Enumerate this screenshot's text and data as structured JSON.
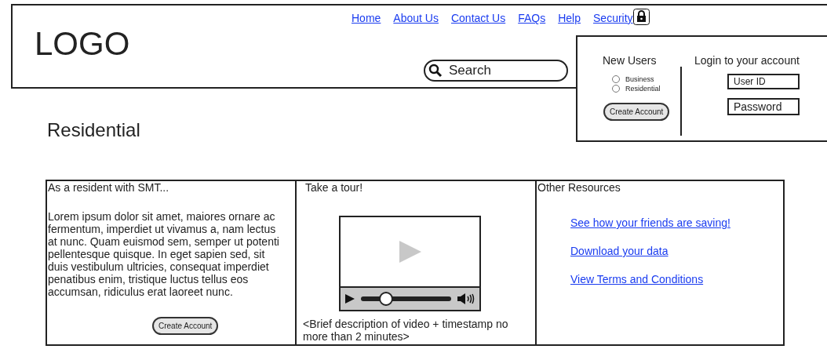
{
  "header": {
    "logo": "LOGO",
    "nav": [
      {
        "label": "Home"
      },
      {
        "label": "About Us"
      },
      {
        "label": "Contact Us"
      },
      {
        "label": "FAQs"
      },
      {
        "label": "Help"
      },
      {
        "label": "Security"
      }
    ],
    "search": {
      "placeholder": "Search"
    }
  },
  "login_panel": {
    "new_users": {
      "title": "New Users",
      "options": [
        {
          "label": "Business",
          "selected": false
        },
        {
          "label": "Residential",
          "selected": false
        }
      ],
      "button": "Create Account"
    },
    "login": {
      "title": "Login to your account",
      "user_id": {
        "placeholder": "User ID"
      },
      "password": {
        "placeholder": "Password"
      }
    }
  },
  "page_title": "Residential",
  "columns": [
    {
      "kind": "text",
      "heading": "As a resident with SMT...",
      "body": "Lorem ipsum dolor sit amet, maiores ornare ac fermentum, imperdiet ut vivamus a, nam lectus at nunc. Quam euismod sem, semper ut potenti pellentesque quisque. In eget sapien sed, sit duis vestibulum ultricies, consequat imperdiet penatibus enim, tristique luctus tellus eos accumsan, ridiculus erat laoreet nunc.",
      "button": "Create Account"
    },
    {
      "kind": "video",
      "heading": "Take a tour!",
      "video": {
        "level": 0.28
      },
      "caption": "<Brief description of video + timestamp no more than 2 minutes>"
    },
    {
      "kind": "links",
      "heading": "Other Resources",
      "links": [
        "See how your friends are saving!",
        "Download your data",
        "View Terms and Conditions"
      ]
    }
  ]
}
